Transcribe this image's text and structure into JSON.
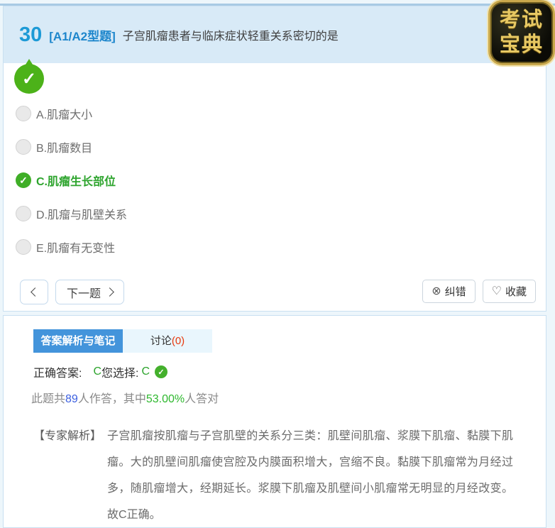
{
  "logo": {
    "line1": "考试",
    "line2": "宝典"
  },
  "question": {
    "number": "30",
    "type_tag": "[A1/A2型题]",
    "text": "子宫肌瘤患者与临床症状轻重关系密切的是",
    "options": [
      {
        "key": "A",
        "label": "A.肌瘤大小",
        "state": "normal"
      },
      {
        "key": "B",
        "label": "B.肌瘤数目",
        "state": "normal"
      },
      {
        "key": "C",
        "label": "C.肌瘤生长部位",
        "state": "selected"
      },
      {
        "key": "D",
        "label": "D.肌瘤与肌壁关系",
        "state": "normal"
      },
      {
        "key": "E",
        "label": "E.肌瘤有无变性",
        "state": "normal"
      }
    ]
  },
  "toolbar": {
    "next_label": "下一题",
    "report_label": "纠错",
    "favorite_label": "收藏"
  },
  "icons": {
    "check": "✓",
    "circle_x": "⊗",
    "heart": "♡"
  },
  "analysis": {
    "tabs": [
      {
        "label": "答案解析与笔记",
        "active": true
      },
      {
        "label": "讨论",
        "count": "(0)",
        "active": false
      }
    ],
    "answer_line": {
      "correct_label": "正确答案:",
      "correct_value": "C",
      "chosen_label": "您选择:",
      "chosen_value": "C"
    },
    "stats": {
      "prefix": "此题共",
      "count": "89",
      "middle": "人作答，其中",
      "percent": "53.00%",
      "suffix": "人答对"
    },
    "expert": {
      "label": "【专家解析】",
      "text": "子宫肌瘤按肌瘤与子宫肌壁的关系分三类：肌壁间肌瘤、浆膜下肌瘤、黏膜下肌瘤。大的肌壁间肌瘤使宫腔及内膜面积增大，宫缩不良。黏膜下肌瘤常为月经过多，随肌瘤增大，经期延长。浆膜下肌瘤及肌壁间小肌瘤常无明显的月经改变。故C正确。"
    }
  },
  "colors": {
    "accent_blue": "#1d9ad6",
    "tab_active_blue": "#4394db",
    "badge_green": "#4cb219",
    "correct_green": "#2da42d",
    "stat_blue": "#3b5fe0",
    "stat_green": "#2eb82e",
    "count_red": "#e8380d",
    "header_bg": "#d8eaf7"
  }
}
